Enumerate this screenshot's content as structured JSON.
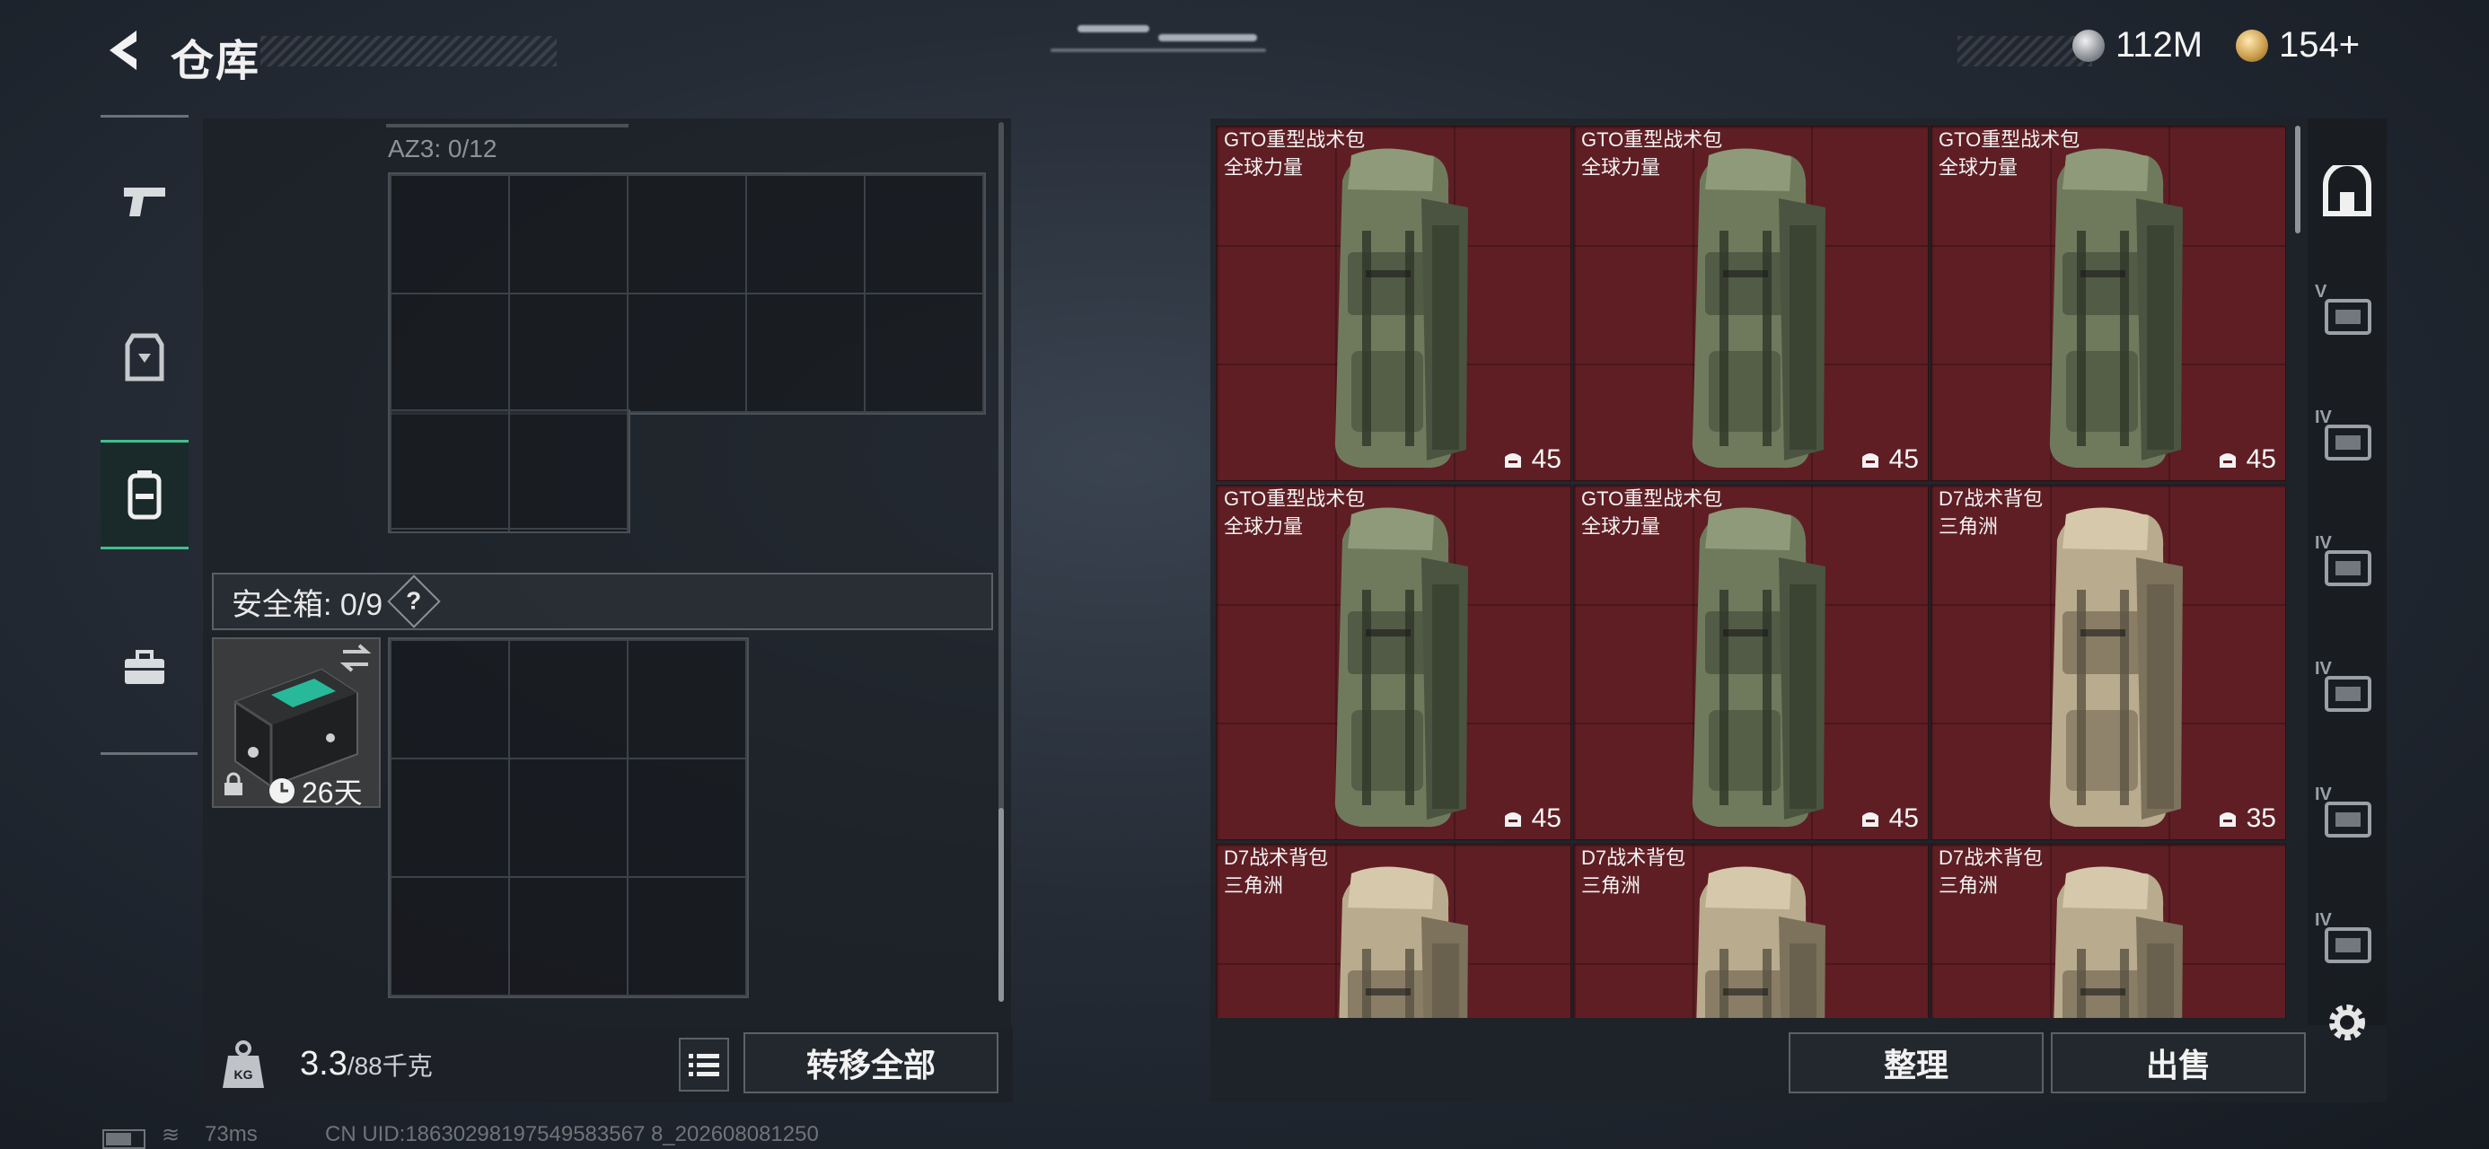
{
  "header": {
    "title": "仓库",
    "currency_silver": "112M",
    "currency_gold": "154+"
  },
  "left_panel": {
    "container_label": "AZ3: 0/12",
    "safe_box": {
      "label": "安全箱: 0/9",
      "help": "?",
      "timer": "26天"
    },
    "weight": {
      "current": "3.3",
      "max": "/88千克"
    },
    "transfer_all": "转移全部"
  },
  "side_tabs": [
    "pistol-icon",
    "armor-icon",
    "backpack-icon",
    "case-icon"
  ],
  "items": [
    {
      "name": "GTO重型战术包",
      "sub": "全球力量",
      "capacity": "45",
      "tone": "green"
    },
    {
      "name": "GTO重型战术包",
      "sub": "全球力量",
      "capacity": "45",
      "tone": "green"
    },
    {
      "name": "GTO重型战术包",
      "sub": "全球力量",
      "capacity": "45",
      "tone": "green"
    },
    {
      "name": "GTO重型战术包",
      "sub": "全球力量",
      "capacity": "45",
      "tone": "green"
    },
    {
      "name": "GTO重型战术包",
      "sub": "全球力量",
      "capacity": "45",
      "tone": "green"
    },
    {
      "name": "D7战术背包",
      "sub": "三角洲",
      "capacity": "35",
      "tone": "tan"
    },
    {
      "name": "D7战术背包",
      "sub": "三角洲",
      "capacity": "",
      "tone": "tan"
    },
    {
      "name": "D7战术背包",
      "sub": "三角洲",
      "capacity": "",
      "tone": "tan"
    },
    {
      "name": "D7战术背包",
      "sub": "三角洲",
      "capacity": "",
      "tone": "tan"
    }
  ],
  "right_tabs": [
    "vault-icon",
    "V",
    "IV",
    "IV",
    "IV",
    "IV",
    "IV"
  ],
  "actions": {
    "organize": "整理",
    "sell": "出售"
  },
  "status": {
    "ping": "73ms",
    "uid": "CN UID:18630298197549583567 8_202608081250"
  },
  "colors": {
    "accent": "#3fbf8e",
    "item_bg": "#5e1e24"
  }
}
